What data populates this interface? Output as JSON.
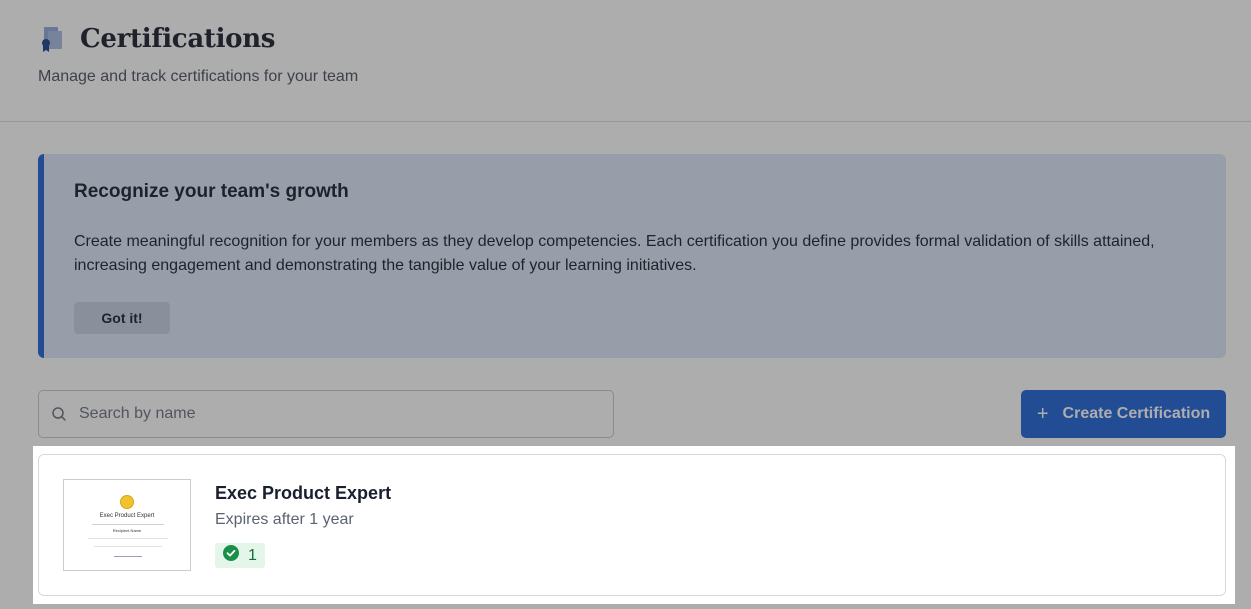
{
  "header": {
    "title": "Certifications",
    "subtitle": "Manage and track certifications for your team"
  },
  "banner": {
    "title": "Recognize your team's growth",
    "text": "Create meaningful recognition for your members as they develop competencies. Each certification you define provides formal validation of skills attained, increasing engagement and demonstrating the tangible value of your learning initiatives.",
    "button_label": "Got it!"
  },
  "search": {
    "placeholder": "Search by name",
    "value": ""
  },
  "toolbar": {
    "create_label": "Create Certification"
  },
  "certifications": [
    {
      "name": "Exec Product Expert",
      "expires": "Expires after 1 year",
      "earned_count": "1",
      "thumbnail": {
        "title": "Exec Product Expert",
        "recipient": "Recipient Name"
      }
    }
  ],
  "colors": {
    "accent": "#1f63d6",
    "banner_bg": "#dce7f8",
    "success": "#1a8f4a",
    "success_bg": "#e4f5ea"
  }
}
